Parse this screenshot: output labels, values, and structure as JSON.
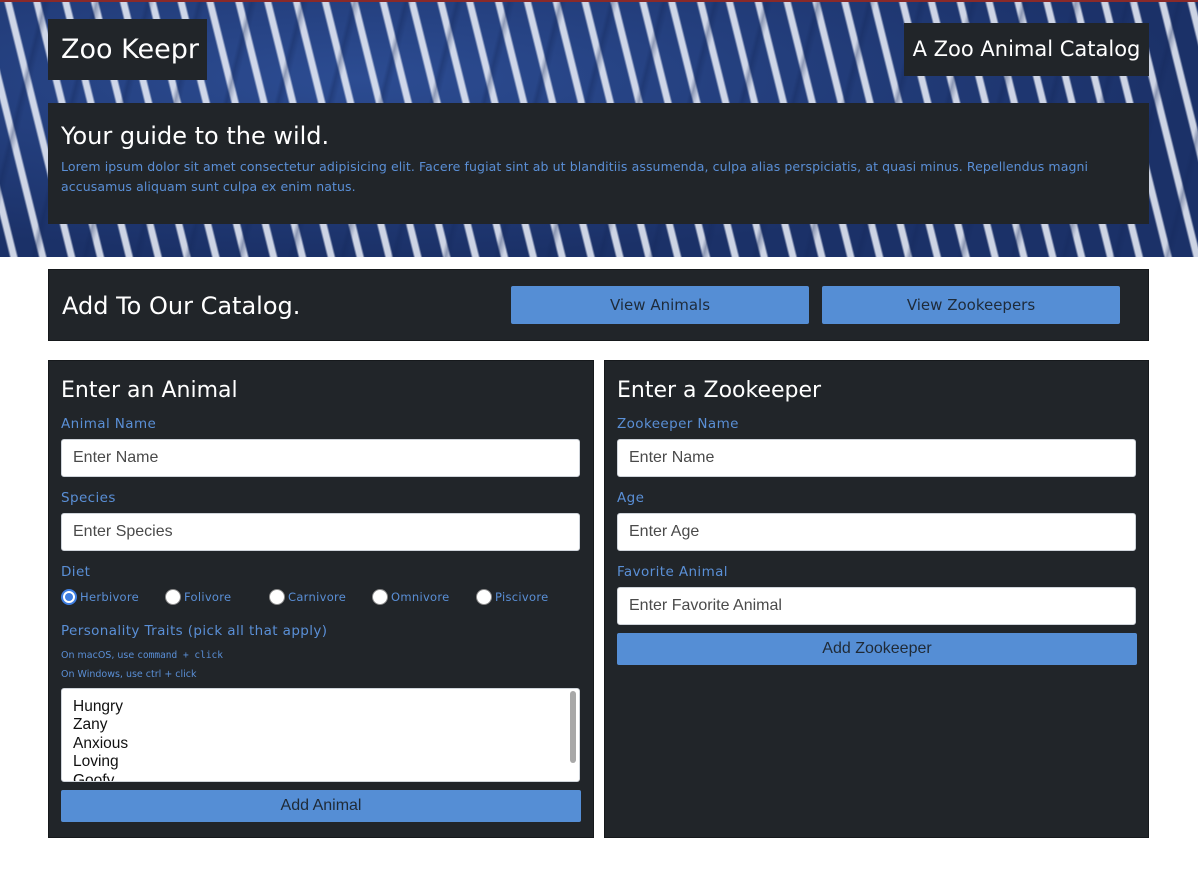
{
  "header": {
    "brand": "Zoo Keepr",
    "tagline": "A Zoo Animal Catalog",
    "intro_title": "Your guide to the wild.",
    "intro_text": "Lorem ipsum dolor sit amet consectetur adipisicing elit. Facere fugiat sint ab ut blanditiis assumenda, culpa alias perspiciatis, at quasi minus. Repellendus magni accusamus aliquam sunt culpa ex enim natus."
  },
  "catalog": {
    "title": "Add To Our Catalog.",
    "view_animals_label": "View Animals",
    "view_zookeepers_label": "View Zookeepers"
  },
  "animal_form": {
    "title": "Enter an Animal",
    "name_label": "Animal Name",
    "name_placeholder": "Enter Name",
    "species_label": "Species",
    "species_placeholder": "Enter Species",
    "diet_label": "Diet",
    "diet_options": [
      {
        "label": "Herbivore",
        "checked": true
      },
      {
        "label": "Folivore",
        "checked": false
      },
      {
        "label": "Carnivore",
        "checked": false
      },
      {
        "label": "Omnivore",
        "checked": false
      },
      {
        "label": "Piscivore",
        "checked": false
      }
    ],
    "traits_label": "Personality Traits (pick all that apply)",
    "tip_mac_prefix": "On macOS, use ",
    "tip_mac_keys": "command + click",
    "tip_windows": "On Windows, use ctrl + click",
    "traits": [
      "Hungry",
      "Zany",
      "Anxious",
      "Loving",
      "Goofy"
    ],
    "submit_label": "Add Animal"
  },
  "zookeeper_form": {
    "title": "Enter a Zookeeper",
    "name_label": "Zookeeper Name",
    "name_placeholder": "Enter Name",
    "age_label": "Age",
    "age_placeholder": "Enter Age",
    "favorite_label": "Favorite Animal",
    "favorite_placeholder": "Enter Favorite Animal",
    "submit_label": "Add Zookeeper"
  },
  "colors": {
    "panel_bg": "#212529",
    "accent_text": "#5a8fd6",
    "button_bg": "#558ed5",
    "hero_blue": "#1f3a78"
  }
}
